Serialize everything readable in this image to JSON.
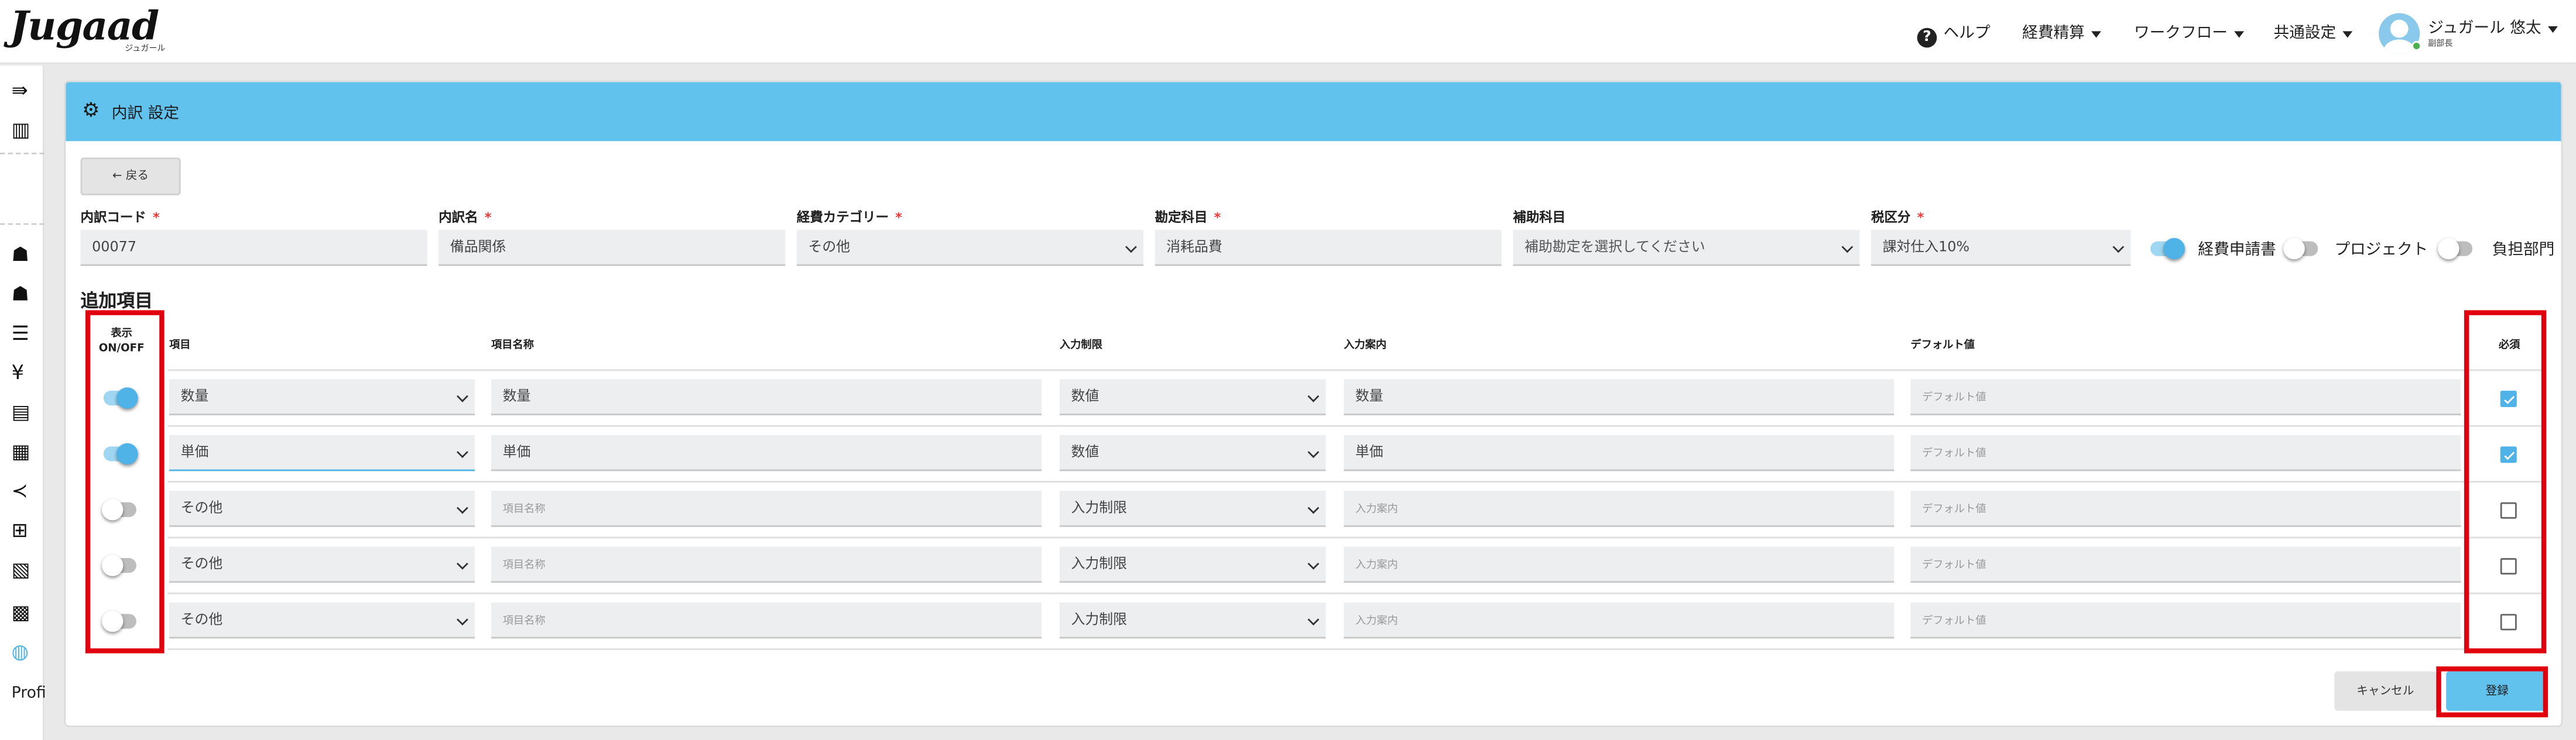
{
  "header": {
    "logo": "Jugaad",
    "logo_sub": "ジュガール",
    "help": "ヘルプ",
    "nav": [
      "経費精算",
      "ワークフロー",
      "共通設定"
    ],
    "user_name": "ジュガール 悠太",
    "user_role": "副部長"
  },
  "sidebar": {
    "icons": [
      "expand-icon",
      "building-icon",
      "users-icon",
      "user-group-icon",
      "list-icon",
      "yen-icon",
      "document-icon",
      "receipt-icon",
      "share-icon",
      "grid-icon",
      "records-icon",
      "book-icon",
      "globe-icon"
    ],
    "footer_label": "Profi"
  },
  "page": {
    "title": "内訳 設定",
    "back_label": "戻る"
  },
  "form": {
    "code_label": "内訳コード",
    "code_value": "00077",
    "name_label": "内訳名",
    "name_value": "備品関係",
    "category_label": "経費カテゴリー",
    "category_value": "その他",
    "account_label": "勘定科目",
    "account_value": "消耗品費",
    "sub_account_label": "補助科目",
    "sub_account_placeholder": "補助勘定を選択してください",
    "tax_label": "税区分",
    "tax_value": "課対仕入10%",
    "required_mark": "*",
    "toggles": [
      {
        "label": "経費申請書",
        "on": true
      },
      {
        "label": "プロジェクト",
        "on": false
      },
      {
        "label": "負担部門",
        "on": false
      }
    ]
  },
  "additional": {
    "section_title": "追加項目",
    "headers": {
      "display_line1": "表示",
      "display_line2": "ON/OFF",
      "item": "項目",
      "item_name": "項目名称",
      "input_limit": "入力制限",
      "input_guide": "入力案内",
      "default": "デフォルト値",
      "required": "必須"
    },
    "rows": [
      {
        "on": true,
        "item": "数量",
        "name": "数量",
        "name_ph": false,
        "limit": "数値",
        "guide": "数量",
        "guide_ph": false,
        "default": "デフォルト値",
        "required": true
      },
      {
        "on": true,
        "item": "単価",
        "name": "単価",
        "name_ph": false,
        "limit": "数値",
        "guide": "単価",
        "guide_ph": false,
        "default": "デフォルト値",
        "required": true
      },
      {
        "on": false,
        "item": "その他",
        "name": "項目名称",
        "name_ph": true,
        "limit": "入力制限",
        "guide": "入力案内",
        "guide_ph": true,
        "default": "デフォルト値",
        "required": false
      },
      {
        "on": false,
        "item": "その他",
        "name": "項目名称",
        "name_ph": true,
        "limit": "入力制限",
        "guide": "入力案内",
        "guide_ph": true,
        "default": "デフォルト値",
        "required": false
      },
      {
        "on": false,
        "item": "その他",
        "name": "項目名称",
        "name_ph": true,
        "limit": "入力制限",
        "guide": "入力案内",
        "guide_ph": true,
        "default": "デフォルト値",
        "required": false
      }
    ]
  },
  "actions": {
    "cancel": "キャンセル",
    "submit": "登録"
  },
  "colors": {
    "header_bar": "#62c2ee",
    "accent": "#4fb3e8",
    "highlight": "#e0000e"
  }
}
